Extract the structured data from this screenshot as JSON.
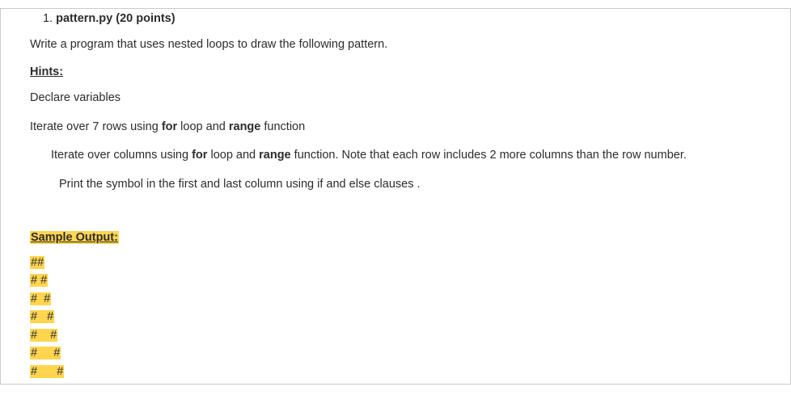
{
  "title": {
    "number": "1. ",
    "text": "pattern.py (20 points)"
  },
  "instruction": "Write a program that uses nested loops to draw the following pattern.",
  "hints_label": "Hints:",
  "hint_declare": "Declare variables",
  "hint_rows": {
    "pre": "Iterate over 7 rows using ",
    "b1": "for",
    "mid1": " loop and ",
    "b2": "range",
    "post": " function"
  },
  "hint_cols": {
    "pre": "Iterate over columns using ",
    "b1": "for",
    "mid1": " loop and ",
    "b2": "range",
    "post": " function. Note that each row includes 2 more columns than the row number."
  },
  "hint_print": "Print the symbol in the first and last column using if and else clauses .",
  "sample_label": "Sample Output:",
  "output": [
    "##",
    "# #",
    "#  #",
    "#   #",
    "#    #",
    "#     #",
    "#      #"
  ]
}
